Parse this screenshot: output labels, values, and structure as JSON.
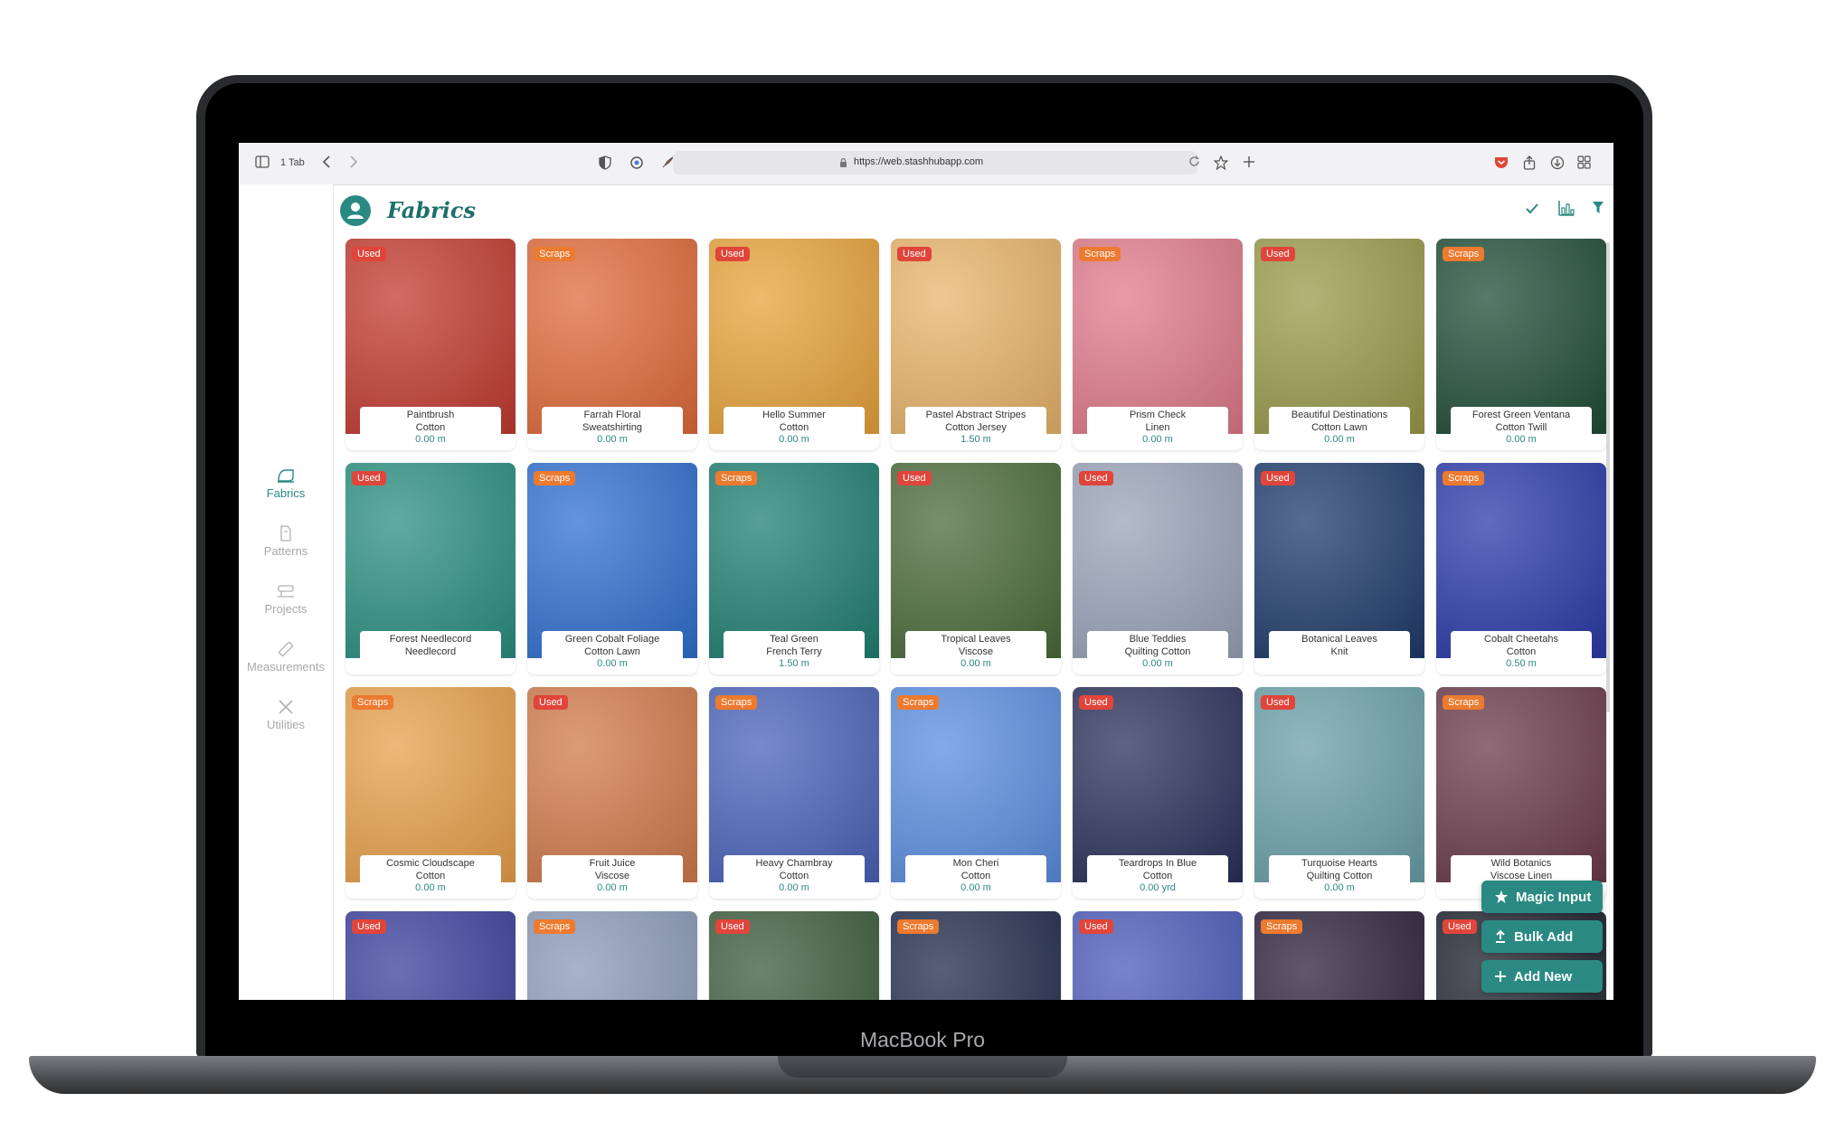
{
  "device": {
    "brand": "MacBook Pro"
  },
  "browser": {
    "tab_count": "1 Tab",
    "url": "https://web.stashhubapp.com"
  },
  "sidebar": {
    "items": [
      {
        "label": "Fabrics",
        "icon": "fabric-icon",
        "active": true
      },
      {
        "label": "Patterns",
        "icon": "pattern-icon",
        "active": false
      },
      {
        "label": "Projects",
        "icon": "sewing-machine-icon",
        "active": false
      },
      {
        "label": "Measurements",
        "icon": "ruler-icon",
        "active": false
      },
      {
        "label": "Utilities",
        "icon": "tools-icon",
        "active": false
      }
    ]
  },
  "header": {
    "title": "Fabrics",
    "actions": [
      "check-icon",
      "chart-icon",
      "filter-icon"
    ]
  },
  "colors": {
    "accent": "#2a8a83",
    "used": "#e0453b",
    "scraps": "#ec7a2f"
  },
  "fabrics": [
    {
      "badge": "Used",
      "name": "Paintbrush",
      "type": "Cotton",
      "length": "0.00 m",
      "color": "#c23a2f"
    },
    {
      "badge": "Scraps",
      "name": "Farrah Floral",
      "type": "Sweatshirting",
      "length": "0.00 m",
      "color": "#e06a3a"
    },
    {
      "badge": "Used",
      "name": "Hello Summer",
      "type": "Cotton",
      "length": "0.00 m",
      "color": "#e8a33a"
    },
    {
      "badge": "Used",
      "name": "Pastel Abstract Stripes",
      "type": "Cotton Jersey",
      "length": "1.50 m",
      "color": "#e9b46b"
    },
    {
      "badge": "Scraps",
      "name": "Prism Check",
      "type": "Linen",
      "length": "0.00 m",
      "color": "#e07a8a"
    },
    {
      "badge": "Used",
      "name": "Beautiful Destinations",
      "type": "Cotton Lawn",
      "length": "0.00 m",
      "color": "#9a9a4a"
    },
    {
      "badge": "Scraps",
      "name": "Forest Green Ventana",
      "type": "Cotton Twill",
      "length": "0.00 m",
      "color": "#1f4d35"
    },
    {
      "badge": "Used",
      "name": "Forest Needlecord",
      "type": "Needlecord",
      "length": "",
      "color": "#2a8f80"
    },
    {
      "badge": "Scraps",
      "name": "Green Cobalt Foliage",
      "type": "Cotton Lawn",
      "length": "0.00 m",
      "color": "#2f6fd0"
    },
    {
      "badge": "Scraps",
      "name": "Teal Green",
      "type": "French Terry",
      "length": "1.50 m",
      "color": "#1f7f72"
    },
    {
      "badge": "Used",
      "name": "Tropical Leaves",
      "type": "Viscose",
      "length": "0.00 m",
      "color": "#4a6a3a"
    },
    {
      "badge": "Used",
      "name": "Blue Teddies",
      "type": "Quilting Cotton",
      "length": "0.00 m",
      "color": "#9aa3b8"
    },
    {
      "badge": "Used",
      "name": "Botanical Leaves",
      "type": "Knit",
      "length": "",
      "color": "#1e3a6a"
    },
    {
      "badge": "Scraps",
      "name": "Cobalt Cheetahs",
      "type": "Cotton",
      "length": "0.50 m",
      "color": "#2a3aa8"
    },
    {
      "badge": "Scraps",
      "name": "Cosmic Cloudscape",
      "type": "Cotton",
      "length": "0.00 m",
      "color": "#e8a04a"
    },
    {
      "badge": "Used",
      "name": "Fruit Juice",
      "type": "Viscose",
      "length": "0.00 m",
      "color": "#d07a4a"
    },
    {
      "badge": "Scraps",
      "name": "Heavy Chambray",
      "type": "Cotton",
      "length": "0.00 m",
      "color": "#4a62b8"
    },
    {
      "badge": "Scraps",
      "name": "Mon Cheri",
      "type": "Cotton",
      "length": "0.00 m",
      "color": "#5a8ee0"
    },
    {
      "badge": "Used",
      "name": "Teardrops In Blue",
      "type": "Cotton",
      "length": "0.00 yrd",
      "color": "#2a2f5a"
    },
    {
      "badge": "Used",
      "name": "Turquoise Hearts",
      "type": "Quilting Cotton",
      "length": "0.00 m",
      "color": "#6aa0a8"
    },
    {
      "badge": "Scraps",
      "name": "Wild Botanics",
      "type": "Viscose Linen",
      "length": "",
      "color": "#6a3a4a"
    },
    {
      "badge": "Used",
      "name": "",
      "type": "",
      "length": "",
      "color": "#3a3f9a"
    },
    {
      "badge": "Scraps",
      "name": "",
      "type": "",
      "length": "",
      "color": "#8a9ab8"
    },
    {
      "badge": "Used",
      "name": "",
      "type": "",
      "length": "",
      "color": "#3a5a3a"
    },
    {
      "badge": "Scraps",
      "name": "",
      "type": "",
      "length": "",
      "color": "#1f2a4a"
    },
    {
      "badge": "Used",
      "name": "",
      "type": "",
      "length": "",
      "color": "#4a5ab8"
    },
    {
      "badge": "Scraps",
      "name": "",
      "type": "",
      "length": "",
      "color": "#2a1f3a"
    },
    {
      "badge": "Used",
      "name": "",
      "type": "",
      "length": "",
      "color": "#1a1f2a"
    }
  ],
  "fab": {
    "magic_input": "Magic Input",
    "bulk_add": "Bulk Add",
    "add_new": "Add New"
  }
}
